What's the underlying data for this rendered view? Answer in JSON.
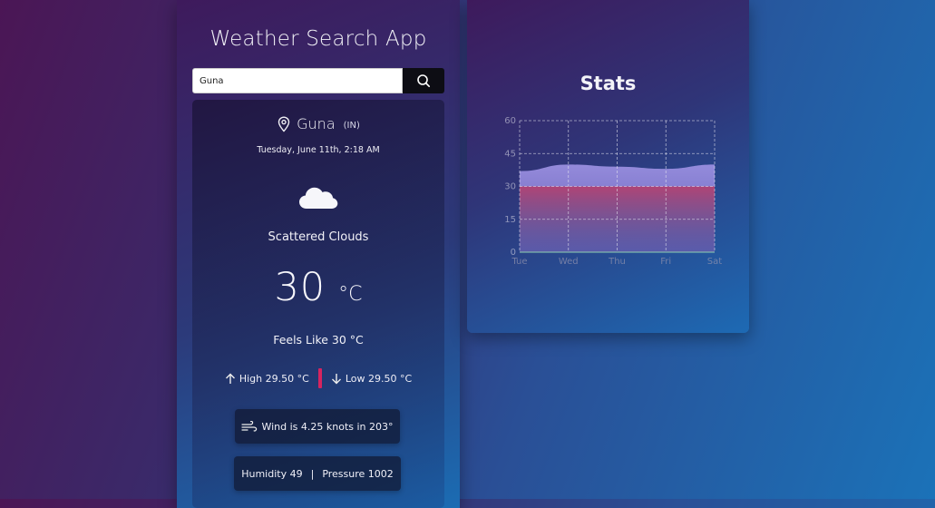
{
  "app": {
    "title": "Weather Search App"
  },
  "search": {
    "value": "Guna",
    "button_icon": "search-icon"
  },
  "weather": {
    "city": "Guna",
    "country": "(IN)",
    "datetime": "Tuesday, June 11th, 2:18 AM",
    "icon": "cloud-icon",
    "description": "Scattered Clouds",
    "temperature": "30",
    "unit": "°C",
    "feels_like": "Feels Like 30 °C",
    "high": "High 29.50 °C",
    "low": "Low 29.50 °C",
    "wind": "Wind is 4.25 knots in 203°",
    "humidity": "Humidity 49",
    "separator": "|",
    "pressure": "Pressure 1002",
    "colors": {
      "divider": "#d6245f"
    }
  },
  "stats": {
    "title": "Stats"
  },
  "chart_data": {
    "type": "area",
    "title": "",
    "xlabel": "",
    "ylabel": "",
    "categories": [
      "Tue",
      "Wed",
      "Thu",
      "Fri",
      "Sat"
    ],
    "ylim": [
      0,
      60
    ],
    "yticks": [
      0,
      15,
      30,
      45,
      60
    ],
    "grid": true,
    "series": [
      {
        "values": [
          37,
          40,
          39,
          38,
          40
        ],
        "color": "#8a86d6"
      },
      {
        "values": [
          30,
          30,
          30,
          30,
          30
        ],
        "color": "#a83f6a"
      }
    ]
  }
}
